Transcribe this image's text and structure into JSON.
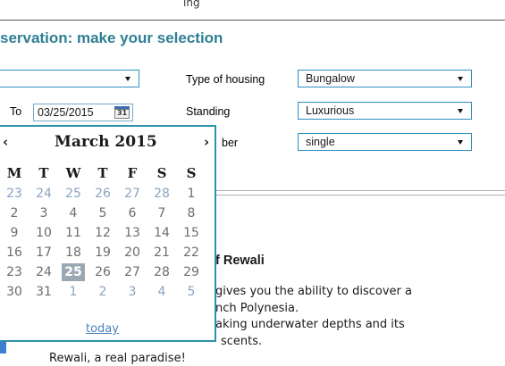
{
  "header": {
    "cut_text": "ing",
    "section_title": "servation: make your selection"
  },
  "form": {
    "from_select": {
      "value": ""
    },
    "to_label": "To",
    "to_date_value": "03/25/2015",
    "calendar_button_icon": "calendar-icon",
    "calendar_button_number": "31",
    "housing_label": "Type of housing",
    "housing_value": "Bungalow",
    "standing_label": "Standing",
    "standing_value": "Luxurious",
    "number_label_fragment": "ber",
    "number_value": "single"
  },
  "datepicker": {
    "prev": "‹",
    "next": "›",
    "month_title": "March 2015",
    "weekdays": [
      "M",
      "T",
      "W",
      "T",
      "F",
      "S",
      "S"
    ],
    "weeks": [
      [
        {
          "d": "23",
          "o": true
        },
        {
          "d": "24",
          "o": true
        },
        {
          "d": "25",
          "o": true
        },
        {
          "d": "26",
          "o": true
        },
        {
          "d": "27",
          "o": true
        },
        {
          "d": "28",
          "o": true
        },
        {
          "d": "1",
          "o": false
        }
      ],
      [
        {
          "d": "2",
          "o": false
        },
        {
          "d": "3",
          "o": false
        },
        {
          "d": "4",
          "o": false
        },
        {
          "d": "5",
          "o": false
        },
        {
          "d": "6",
          "o": false
        },
        {
          "d": "7",
          "o": false
        },
        {
          "d": "8",
          "o": false
        }
      ],
      [
        {
          "d": "9",
          "o": false
        },
        {
          "d": "10",
          "o": false
        },
        {
          "d": "11",
          "o": false
        },
        {
          "d": "12",
          "o": false
        },
        {
          "d": "13",
          "o": false
        },
        {
          "d": "14",
          "o": false
        },
        {
          "d": "15",
          "o": false
        }
      ],
      [
        {
          "d": "16",
          "o": false
        },
        {
          "d": "17",
          "o": false
        },
        {
          "d": "18",
          "o": false
        },
        {
          "d": "19",
          "o": false
        },
        {
          "d": "20",
          "o": false
        },
        {
          "d": "21",
          "o": false
        },
        {
          "d": "22",
          "o": false
        }
      ],
      [
        {
          "d": "23",
          "o": false
        },
        {
          "d": "24",
          "o": false
        },
        {
          "d": "25",
          "o": false,
          "sel": true
        },
        {
          "d": "26",
          "o": false
        },
        {
          "d": "27",
          "o": false
        },
        {
          "d": "28",
          "o": false
        },
        {
          "d": "29",
          "o": false
        }
      ],
      [
        {
          "d": "30",
          "o": false
        },
        {
          "d": "31",
          "o": false
        },
        {
          "d": "1",
          "o": true
        },
        {
          "d": "2",
          "o": true
        },
        {
          "d": "3",
          "o": true
        },
        {
          "d": "4",
          "o": true
        },
        {
          "d": "5",
          "o": true
        }
      ]
    ],
    "today_label": "today"
  },
  "content": {
    "title_fragment": "f Rewali",
    "lines": [
      "gives you the ability to discover a",
      "nch Polynesia.",
      "aking underwater depths and its",
      "scents.",
      "Rewali, a real paradise!"
    ]
  },
  "colors": {
    "accent": "#2f7f94",
    "select_border": "#2d8fc0",
    "datepicker_border": "#2b93a8",
    "selected_day_bg": "#9aa8b4",
    "link": "#4a82c0"
  }
}
